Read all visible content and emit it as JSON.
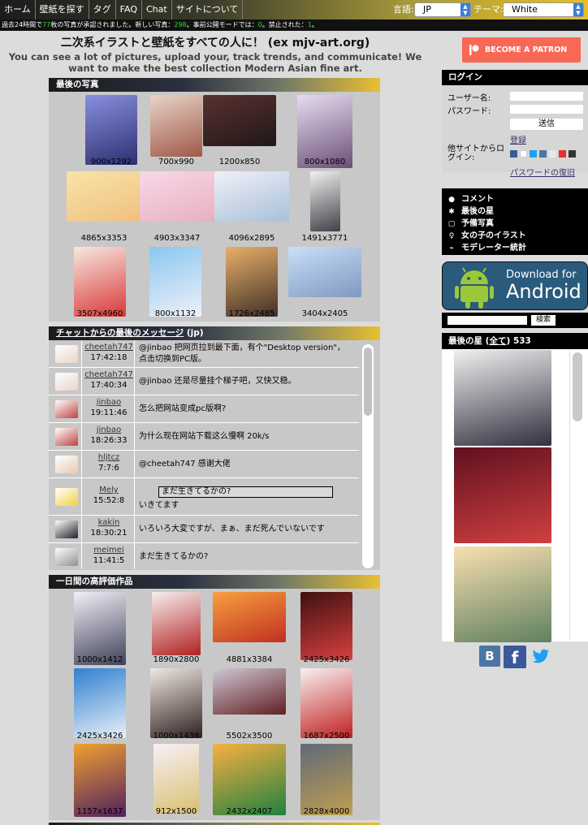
{
  "nav": {
    "items": [
      "ホーム",
      "壁紙を探す",
      "タグ",
      "FAQ",
      "Chat",
      "サイトについて"
    ],
    "lang_label": "言語:",
    "lang_value": "JP",
    "theme_label": "テーマ:",
    "theme_value": "White"
  },
  "stats": {
    "prefix": "過去24時間で",
    "count1": "77",
    "mid1": "枚の写真が承認されました。新しい写真：",
    "count2": "298",
    "mid2": "。事前公開モードでは：",
    "count3": "0",
    "mid3": "。禁止された：",
    "count4": "1",
    "suffix": "。"
  },
  "header": {
    "title": "二次系イラストと壁紙をすべての人に！ (ex mjv-art.org)",
    "desc": "You can see a lot of pictures, upload your, track trends, and communicate! We want to make the best collection Modern Asian fine art."
  },
  "latest": {
    "title": "最後の写真",
    "items": [
      {
        "dim": "900x1292",
        "c1": "#8a8fe0",
        "c2": "#2b3070"
      },
      {
        "dim": "700x990",
        "c1": "#e8d4c8",
        "c2": "#a05848"
      },
      {
        "dim": "1200x850",
        "c1": "#5a3030",
        "c2": "#201818"
      },
      {
        "dim": "800x1080",
        "c1": "#e8dcf0",
        "c2": "#6a5078"
      },
      {
        "dim": "4865x3353",
        "c1": "#f8e4a8",
        "c2": "#f0c080"
      },
      {
        "dim": "4903x3347",
        "c1": "#f8d8e8",
        "c2": "#e8b0c0"
      },
      {
        "dim": "4096x2895",
        "c1": "#f0f0f8",
        "c2": "#a8c0d8"
      },
      {
        "dim": "1491x3771",
        "c1": "#f0f0f0",
        "c2": "#404048"
      },
      {
        "dim": "3507x4960",
        "c1": "#f8e8e0",
        "c2": "#d83838"
      },
      {
        "dim": "800x1132",
        "c1": "#88c8f0",
        "c2": "#f0f0f8"
      },
      {
        "dim": "1726x2485",
        "c1": "#e8b068",
        "c2": "#403028"
      },
      {
        "dim": "3404x2405",
        "c1": "#c8e0f8",
        "c2": "#8098c0"
      }
    ]
  },
  "chat": {
    "title": "チャットからの最後のメッセージ",
    "suffix": "(jp)",
    "rows": [
      {
        "user": "cheetah747",
        "time": "17:42:18",
        "msg": "@jinbao 把网页拉到最下面，有个\"Desktop version\"，点击切换到PC版。"
      },
      {
        "user": "cheetah747",
        "time": "17:40:34",
        "msg": "@jinbao 还是尽量挂个梯子吧，又快又稳。"
      },
      {
        "user": "jinbao",
        "time": "19:11:46",
        "msg": "怎么把网站变成pc版啊?"
      },
      {
        "user": "jinbao",
        "time": "18:26:33",
        "msg": "为什么现在网站下载这么慢啊 20k/s"
      },
      {
        "user": "hljtcz",
        "time": "7:7:6",
        "msg": "@cheetah747 感谢大佬"
      },
      {
        "user": "Mely",
        "time": "15:52:8",
        "quote": "まだ生きてるかの?",
        "msg": "いきてます"
      },
      {
        "user": "kakin",
        "time": "18:30:21",
        "msg": "いろいろ大変ですが、まぁ、まだ死んでいないです"
      },
      {
        "user": "meimei",
        "time": "11:41:5",
        "msg": "まだ生きてるかの?"
      }
    ]
  },
  "top": {
    "title": "一日間の高評価作品",
    "items": [
      {
        "dim": "1000x1412",
        "c1": "#f0f0f8",
        "c2": "#404058"
      },
      {
        "dim": "1890x2800",
        "c1": "#f8f0f0",
        "c2": "#b02020"
      },
      {
        "dim": "4881x3384",
        "c1": "#f8a040",
        "c2": "#c03020"
      },
      {
        "dim": "2425x3426",
        "c1": "#401010",
        "c2": "#d84040"
      },
      {
        "dim": "2425x3426",
        "c1": "#3080d0",
        "c2": "#e8f0f8"
      },
      {
        "dim": "1000x1438",
        "c1": "#f0e8e0",
        "c2": "#302020"
      },
      {
        "dim": "5502x3500",
        "c1": "#d0c8d8",
        "c2": "#602020"
      },
      {
        "dim": "1687x2500",
        "c1": "#f8f0f0",
        "c2": "#c02020"
      },
      {
        "dim": "1157x1637",
        "c1": "#f0a030",
        "c2": "#502060"
      },
      {
        "dim": "912x1500",
        "c1": "#f8f0f8",
        "c2": "#d8c070"
      },
      {
        "dim": "2432x2407",
        "c1": "#f8b040",
        "c2": "#208040"
      },
      {
        "dim": "2828x4000",
        "c1": "#606878",
        "c2": "#c0a050"
      }
    ]
  },
  "patron": {
    "label": "BECOME A PATRON"
  },
  "login": {
    "title": "ログイン",
    "user_label": "ユーザー名:",
    "pass_label": "パスワード:",
    "submit": "送信",
    "register": "登録",
    "other_site": "他サイトからログイン:",
    "recover": "パスワードの復旧"
  },
  "menu": {
    "items": [
      {
        "label": "コメント",
        "icon": "comment-icon"
      },
      {
        "label": "最後の星",
        "icon": "star-icon"
      },
      {
        "label": "予備写真",
        "icon": "picture-icon"
      },
      {
        "label": "女の子のイラスト",
        "icon": "girl-icon"
      },
      {
        "label": "モデレーター統計",
        "icon": "stats-icon"
      }
    ]
  },
  "android": {
    "line1": "Download for",
    "line2": "Android"
  },
  "search": {
    "button": "検索"
  },
  "stars": {
    "title": "最後の星",
    "all_link": "全て",
    "count": "533",
    "items": [
      {
        "c1": "#f0f0f0",
        "c2": "#303040"
      },
      {
        "c1": "#601020",
        "c2": "#d04040"
      },
      {
        "c1": "#f8e0b0",
        "c2": "#608060"
      }
    ]
  },
  "social": {
    "vk": "B",
    "fb": "f",
    "tw": "t"
  },
  "colors": {
    "accent": "#e8c020",
    "patron": "#f96854",
    "stats_green": "#2fdc2f"
  }
}
